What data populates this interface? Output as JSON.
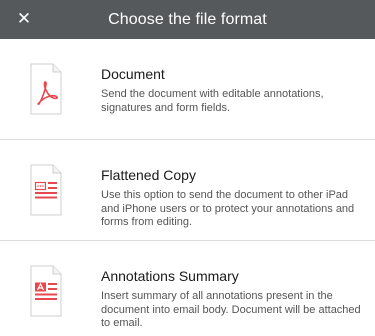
{
  "header": {
    "title": "Choose the file format",
    "close_glyph": "✕"
  },
  "options": [
    {
      "title": "Document",
      "description": "Send the document with editable annotations, signatures and form fields.",
      "icon": "pdf-document-icon"
    },
    {
      "title": "Flattened Copy",
      "description": "Use this option to send the document to other iPad and iPhone users or to protect your annotations and forms from editing.",
      "icon": "flattened-copy-icon"
    },
    {
      "title": "Annotations Summary",
      "description": "Insert summary of all annotations present in the document into email body. Document will be attached to email.",
      "icon": "annotations-summary-icon"
    }
  ],
  "colors": {
    "header_bg": "#56595c",
    "accent_red": "#e8474d"
  }
}
